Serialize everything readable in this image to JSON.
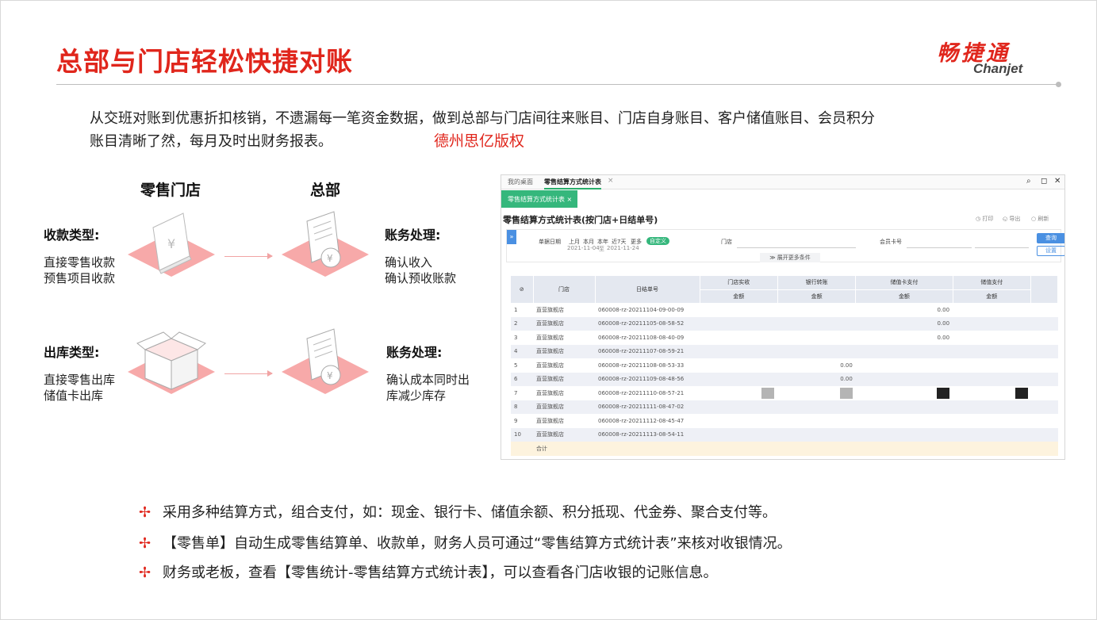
{
  "header": {
    "title": "总部与门店轻松快捷对账",
    "logo_cn": "畅捷通",
    "logo_en": "Chanjet"
  },
  "description": {
    "line1": "从交班对账到优惠折扣核销，不遗漏每一笔资金数据，做到总部与门店间往来账目、门店自身账目、客户储值账目、会员积分",
    "line2": "账目清晰了然，每月及时出财务报表。",
    "copyright": "德州思亿版权"
  },
  "flow": {
    "col_store": "零售门店",
    "col_hq": "总部",
    "row1": {
      "left_label": "收款类型:",
      "left_items": [
        "直接零售收款",
        "预售项目收款"
      ],
      "right_label": "账务处理:",
      "right_items": [
        "确认收入",
        "确认预收账款"
      ]
    },
    "row2": {
      "left_label": "出库类型:",
      "left_items": [
        "直接零售出库",
        "储值卡出库"
      ],
      "right_label": "账务处理:",
      "right_items": [
        "确认成本同时出",
        "库减少库存"
      ]
    }
  },
  "app": {
    "tabs": [
      "我的桌面",
      "零售结算方式统计表"
    ],
    "subtab": "零售结算方式统计表 ×",
    "report_title": "零售结算方式统计表(按门店+日结单号)",
    "actions": [
      "打印",
      "导出",
      "刷新"
    ],
    "filter": {
      "date_label": "单据日期",
      "ranges": [
        "上月",
        "本月",
        "本年",
        "近7天",
        "更多"
      ],
      "custom": "自定义",
      "date_from": "2021-11-04",
      "date_to": "2021-11-24",
      "date_sep": "至",
      "store_label": "门店",
      "card_label": "会员卡号",
      "query": "查询",
      "settings": "设置",
      "more": "展开更多条件"
    },
    "table": {
      "headers": [
        "门店",
        "日结单号",
        "门店实收",
        "银行转账",
        "储值卡支付",
        "储值支付"
      ],
      "subheader": "金额",
      "rows": [
        {
          "no": "1",
          "store": "直营旗舰店",
          "code": "060008-rz-20211104-09-00-09",
          "v": "0.00"
        },
        {
          "no": "2",
          "store": "直营旗舰店",
          "code": "060008-rz-20211105-08-58-52",
          "v": "0.00"
        },
        {
          "no": "3",
          "store": "直营旗舰店",
          "code": "060008-rz-20211108-08-40-09",
          "v": "0.00"
        },
        {
          "no": "4",
          "store": "直营旗舰店",
          "code": "060008-rz-20211107-08-59-21",
          "v": ""
        },
        {
          "no": "5",
          "store": "直营旗舰店",
          "code": "060008-rz-20211108-08-53-33",
          "v": "0.00"
        },
        {
          "no": "6",
          "store": "直营旗舰店",
          "code": "060008-rz-20211109-08-48-56",
          "v": "0.00"
        },
        {
          "no": "7",
          "store": "直营旗舰店",
          "code": "060008-rz-20211110-08-57-21",
          "v": ""
        },
        {
          "no": "8",
          "store": "直营旗舰店",
          "code": "060008-rz-20211111-08-47-02",
          "v": ""
        },
        {
          "no": "9",
          "store": "直营旗舰店",
          "code": "060008-rz-20211112-08-45-47",
          "v": ""
        },
        {
          "no": "10",
          "store": "直营旗舰店",
          "code": "060008-rz-20211113-08-54-11",
          "v": ""
        }
      ],
      "total": "合计"
    }
  },
  "bullets": [
    "采用多种结算方式，组合支付，如：现金、银行卡、储值余额、积分抵现、代金券、聚合支付等。",
    "【零售单】自动生成零售结算单、收款单，财务人员可通过“零售结算方式统计表”来核对收银情况。",
    "财务或老板，查看【零售统计-零售结算方式统计表】，可以查看各门店收银的记账信息。"
  ],
  "colors": {
    "accent": "#e0261c",
    "iso_pink": "#f7a9a9",
    "app_green": "#35b77c",
    "app_blue": "#4a90e2"
  }
}
